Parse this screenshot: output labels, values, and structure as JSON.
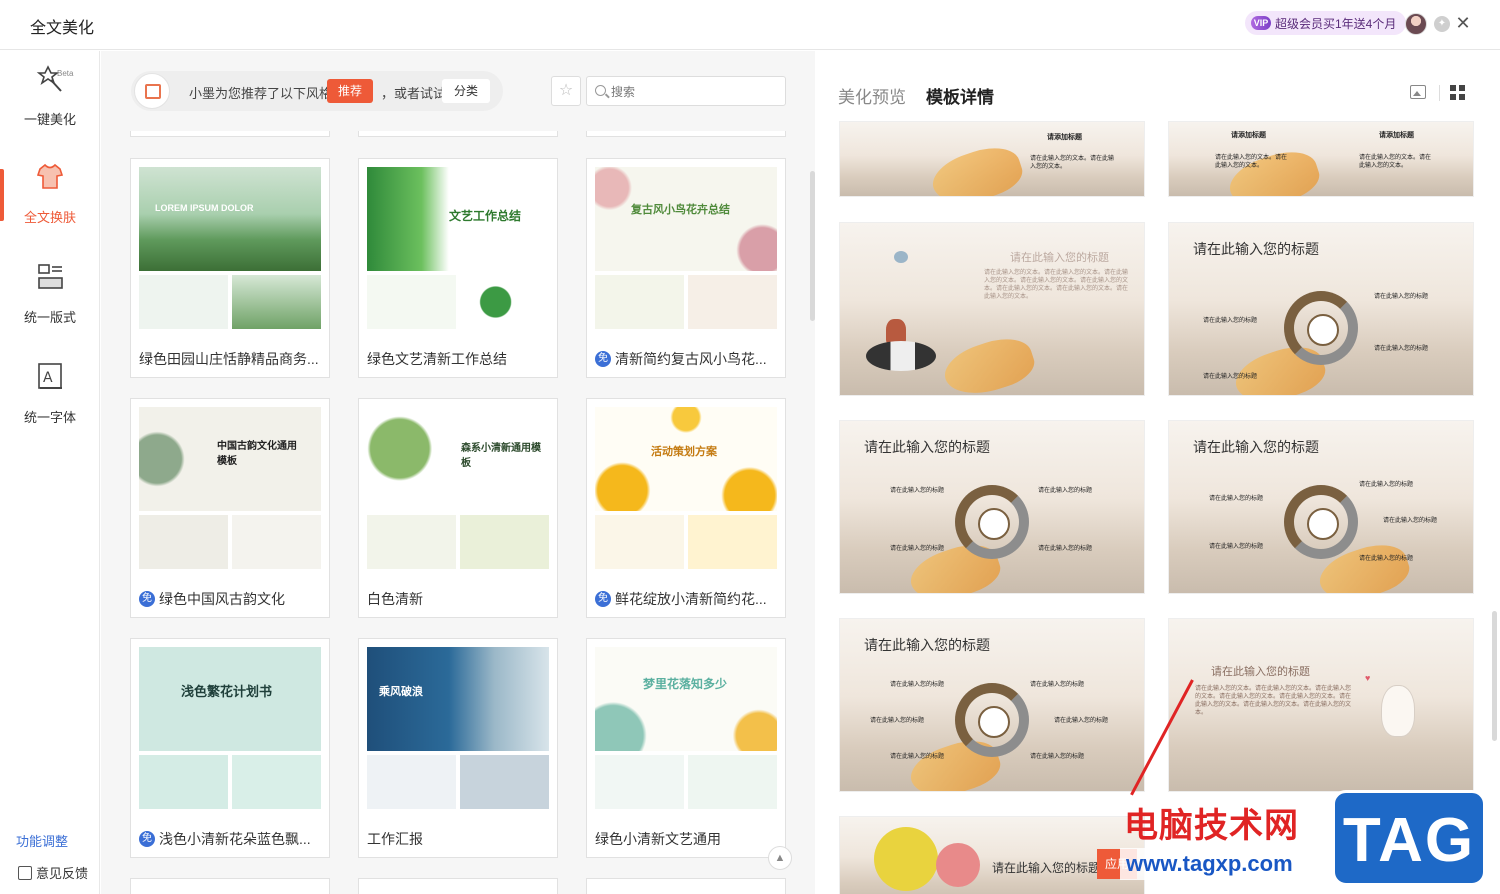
{
  "app": {
    "title": "全文美化"
  },
  "header": {
    "vip_icon": "VIP",
    "vip_text": "超级会员买1年送4个月"
  },
  "sidebar": {
    "beta": "Beta",
    "items": [
      {
        "label": "一键美化",
        "icon": "magic-wand-icon"
      },
      {
        "label": "全文换肤",
        "icon": "tshirt-icon"
      },
      {
        "label": "统一版式",
        "icon": "layout-icon"
      },
      {
        "label": "统一字体",
        "icon": "font-icon"
      }
    ],
    "func_adjust": "功能调整",
    "feedback": "意见反馈"
  },
  "recommend": {
    "text": "小墨为您推荐了以下风格",
    "btn": "推荐",
    "or_text": "，或者试试",
    "category": "分类"
  },
  "search": {
    "placeholder": "搜索"
  },
  "templates": [
    {
      "name": "绿色田园山庄恬静精品商务...",
      "free": false,
      "cover_title": "LOREM IPSUM DOLOR"
    },
    {
      "name": "绿色文艺清新工作总结",
      "free": false,
      "cover_title": "文艺工作总结"
    },
    {
      "name": "清新简约复古风小鸟花...",
      "free": true,
      "cover_title": "复古风小鸟花卉总结"
    },
    {
      "name": "绿色中国风古韵文化",
      "free": true,
      "cover_title": "中国古韵文化通用模板"
    },
    {
      "name": "白色清新",
      "free": false,
      "cover_title": "森系小清新通用模板"
    },
    {
      "name": "鲜花绽放小清新简约花...",
      "free": true,
      "cover_title": "活动策划方案"
    },
    {
      "name": "浅色小清新花朵蓝色飘...",
      "free": true,
      "cover_title": "浅色繁花计划书"
    },
    {
      "name": "工作汇报",
      "free": false,
      "cover_title": "乘风破浪"
    },
    {
      "name": "绿色小清新文艺通用",
      "free": false,
      "cover_title": "梦里花落知多少"
    }
  ],
  "free_badge": "免",
  "right": {
    "tab_preview": "美化预览",
    "tab_detail": "模板详情",
    "slides": [
      {
        "title": "请添加标题",
        "text": "请在此输入您的文本。请在此输入您的文本。"
      },
      {
        "title": "请添加标题",
        "text": "请在此输入您的文本。请在此输入您的文本。"
      },
      {
        "title": "请在此输入您的标题",
        "text": "请在此输入您的文本。"
      },
      {
        "title": "请在此输入您的标题",
        "text": "请在此输入您的标题"
      },
      {
        "title": "请在此输入您的标题",
        "text": "请在此输入您的标题"
      },
      {
        "title": "请在此输入您的标题",
        "text": "请在此输入您的标题"
      },
      {
        "title": "请在此输入您的标题",
        "text": "请在此输入您的标题"
      },
      {
        "title": "请在此输入您的标题",
        "text": "请在此输入您的文本。"
      },
      {
        "title": "请在此输入您的标题",
        "text": ""
      }
    ],
    "apply_btn": "应用"
  },
  "watermark": {
    "site_cn": "电脑技术网",
    "url": "www.tagxp.com",
    "tag": "TAG"
  }
}
